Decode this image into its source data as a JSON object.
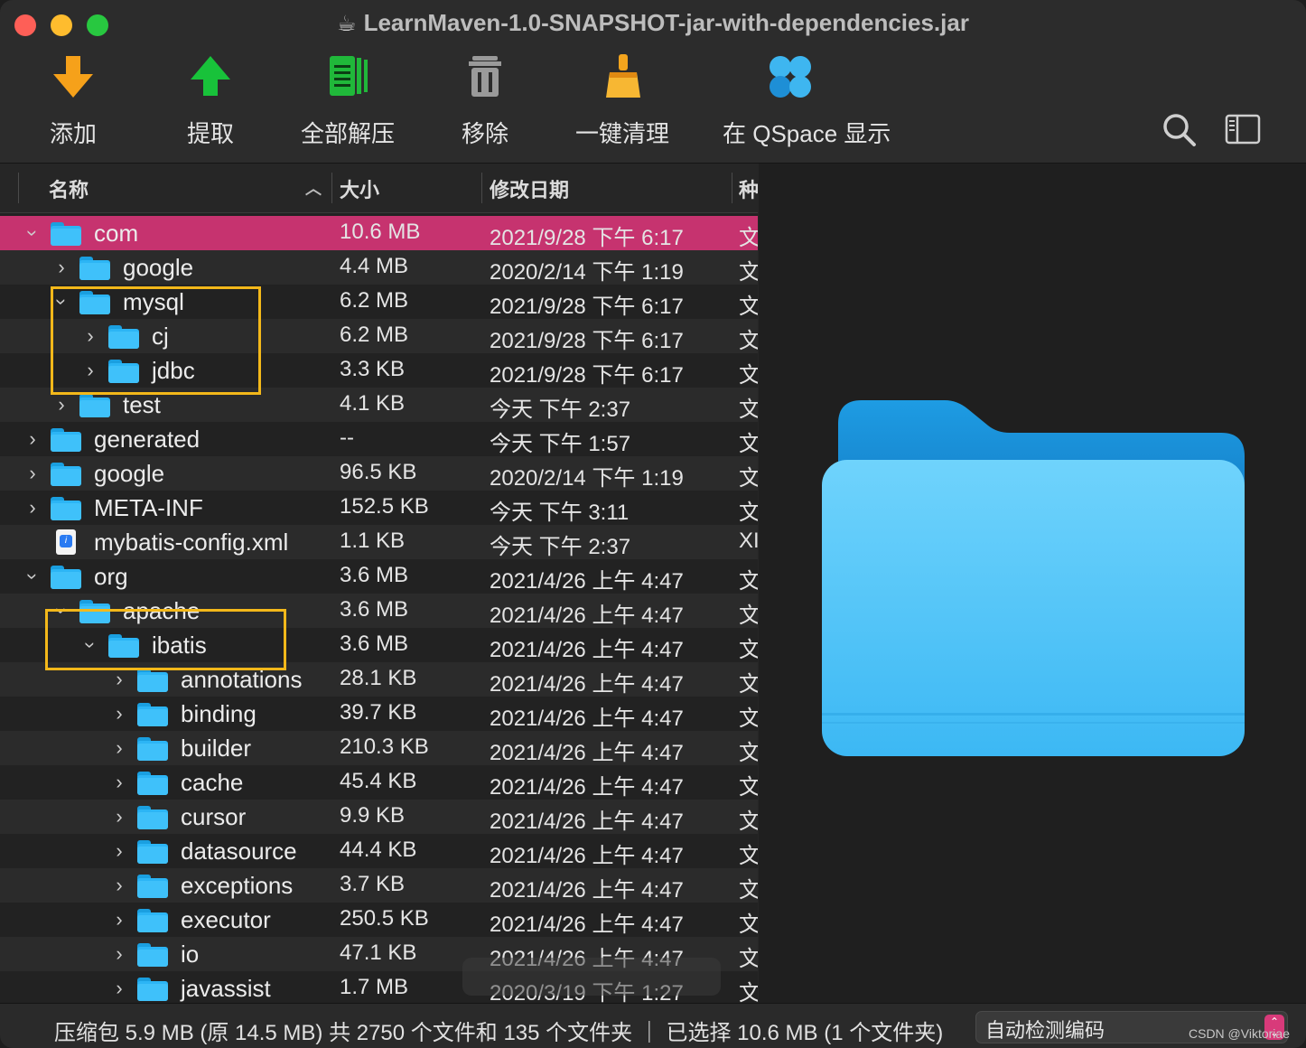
{
  "window": {
    "title": "LearnMaven-1.0-SNAPSHOT-jar-with-dependencies.jar",
    "title_icon": "coffee-cup-icon"
  },
  "toolbar": {
    "add": "添加",
    "extract": "提取",
    "extract_all": "全部解压",
    "remove": "移除",
    "cleanup": "一键清理",
    "qspace": "在 QSpace 显示"
  },
  "columns": {
    "name": "名称",
    "size": "大小",
    "date": "修改日期",
    "kind": "种"
  },
  "rows": [
    {
      "name": "com",
      "size": "10.6 MB",
      "date": "2021/9/28 下午 6:17",
      "kind": "文"
    },
    {
      "name": "google",
      "size": "4.4 MB",
      "date": "2020/2/14 下午 1:19",
      "kind": "文"
    },
    {
      "name": "mysql",
      "size": "6.2 MB",
      "date": "2021/9/28 下午 6:17",
      "kind": "文"
    },
    {
      "name": "cj",
      "size": "6.2 MB",
      "date": "2021/9/28 下午 6:17",
      "kind": "文"
    },
    {
      "name": "jdbc",
      "size": "3.3 KB",
      "date": "2021/9/28 下午 6:17",
      "kind": "文"
    },
    {
      "name": "test",
      "size": "4.1 KB",
      "date": "今天 下午 2:37",
      "kind": "文"
    },
    {
      "name": "generated",
      "size": "--",
      "date": "今天 下午 1:57",
      "kind": "文"
    },
    {
      "name": "google",
      "size": "96.5 KB",
      "date": "2020/2/14 下午 1:19",
      "kind": "文"
    },
    {
      "name": "META-INF",
      "size": "152.5 KB",
      "date": "今天 下午 3:11",
      "kind": "文"
    },
    {
      "name": "mybatis-config.xml",
      "size": "1.1 KB",
      "date": "今天 下午 2:37",
      "kind": "XI"
    },
    {
      "name": "org",
      "size": "3.6 MB",
      "date": "2021/4/26 上午 4:47",
      "kind": "文"
    },
    {
      "name": "apache",
      "size": "3.6 MB",
      "date": "2021/4/26 上午 4:47",
      "kind": "文"
    },
    {
      "name": "ibatis",
      "size": "3.6 MB",
      "date": "2021/4/26 上午 4:47",
      "kind": "文"
    },
    {
      "name": "annotations",
      "size": "28.1 KB",
      "date": "2021/4/26 上午 4:47",
      "kind": "文"
    },
    {
      "name": "binding",
      "size": "39.7 KB",
      "date": "2021/4/26 上午 4:47",
      "kind": "文"
    },
    {
      "name": "builder",
      "size": "210.3 KB",
      "date": "2021/4/26 上午 4:47",
      "kind": "文"
    },
    {
      "name": "cache",
      "size": "45.4 KB",
      "date": "2021/4/26 上午 4:47",
      "kind": "文"
    },
    {
      "name": "cursor",
      "size": "9.9 KB",
      "date": "2021/4/26 上午 4:47",
      "kind": "文"
    },
    {
      "name": "datasource",
      "size": "44.4 KB",
      "date": "2021/4/26 上午 4:47",
      "kind": "文"
    },
    {
      "name": "exceptions",
      "size": "3.7 KB",
      "date": "2021/4/26 上午 4:47",
      "kind": "文"
    },
    {
      "name": "executor",
      "size": "250.5 KB",
      "date": "2021/4/26 上午 4:47",
      "kind": "文"
    },
    {
      "name": "io",
      "size": "47.1 KB",
      "date": "2021/4/26 上午 4:47",
      "kind": "文"
    },
    {
      "name": "javassist",
      "size": "1.7 MB",
      "date": "2020/3/19 下午 1:27",
      "kind": "文"
    }
  ],
  "status": {
    "summary": "压缩包 5.9 MB (原 14.5 MB) 共 2750 个文件和 135 个文件夹 ｜ 已选择 10.6 MB (1 个文件夹)",
    "encoding": "自动检测编码"
  },
  "watermark": "CSDN @Viktoriae",
  "colors": {
    "selection": "#c6336f",
    "highlight_box": "#f3b81a",
    "folder": "#2cb5f5"
  }
}
